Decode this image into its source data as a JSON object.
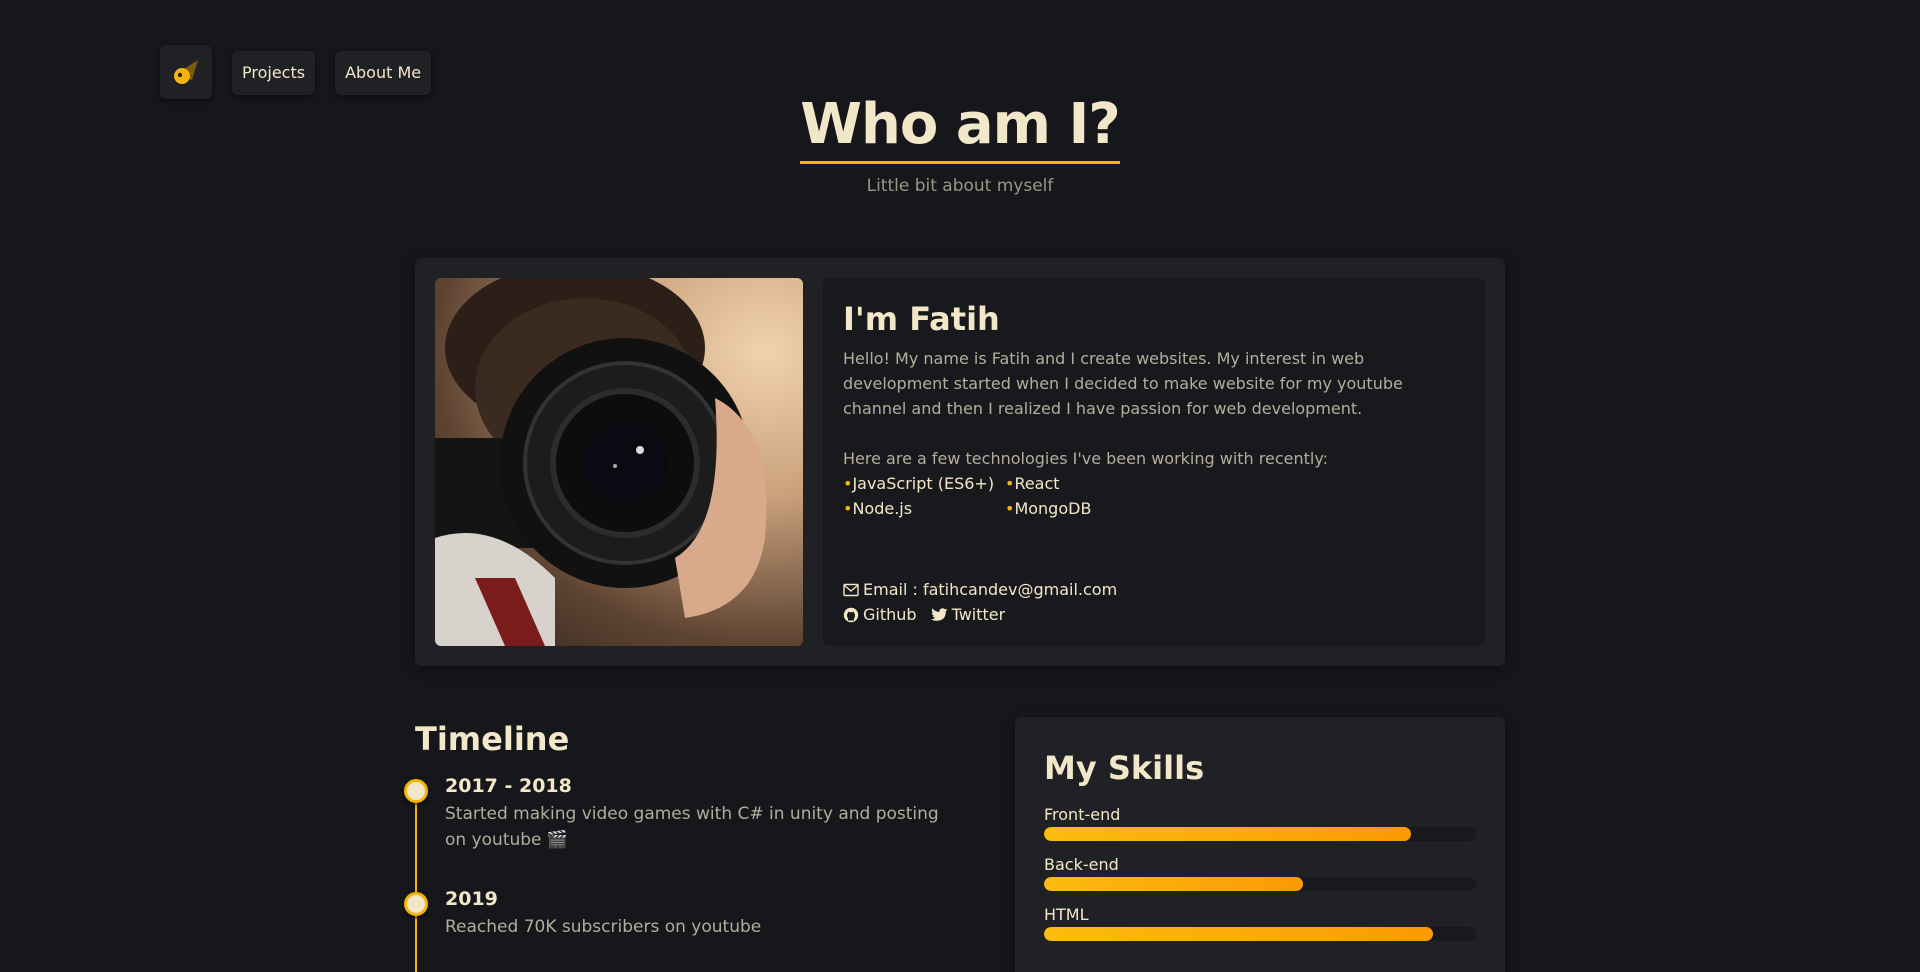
{
  "nav": {
    "projects_label": "Projects",
    "about_label": "About Me"
  },
  "header": {
    "title": "Who am I?",
    "subtitle": "Little bit about myself"
  },
  "about": {
    "heading": "I'm Fatih",
    "intro": "Hello! My name is Fatih and I create websites. My interest in web development started when I decided to make website for my youtube channel and then I realized I have passion for web development.",
    "tech_intro": "Here are a few technologies I've been working with recently:",
    "technologies": [
      "JavaScript (ES6+)",
      "React",
      "Node.js",
      "MongoDB"
    ],
    "email_text": "Email : fatihcandev@gmail.com",
    "github_label": "Github",
    "twitter_label": "Twitter"
  },
  "timeline": {
    "title": "Timeline",
    "items": [
      {
        "year": "2017 - 2018",
        "description": "Started making video games with C# in unity and posting on youtube 🎬"
      },
      {
        "year": "2019",
        "description": "Reached 70K subscribers on youtube"
      }
    ]
  },
  "skills": {
    "title": "My Skills",
    "items": [
      {
        "label": "Front-end",
        "level": 0.85
      },
      {
        "label": "Back-end",
        "level": 0.6
      },
      {
        "label": "HTML",
        "level": 0.9
      }
    ]
  },
  "colors": {
    "background": "#16171a",
    "card": "#202125",
    "accent": "#f5b40c",
    "text": "#f3e7c9",
    "muted": "#b4ad9e"
  }
}
